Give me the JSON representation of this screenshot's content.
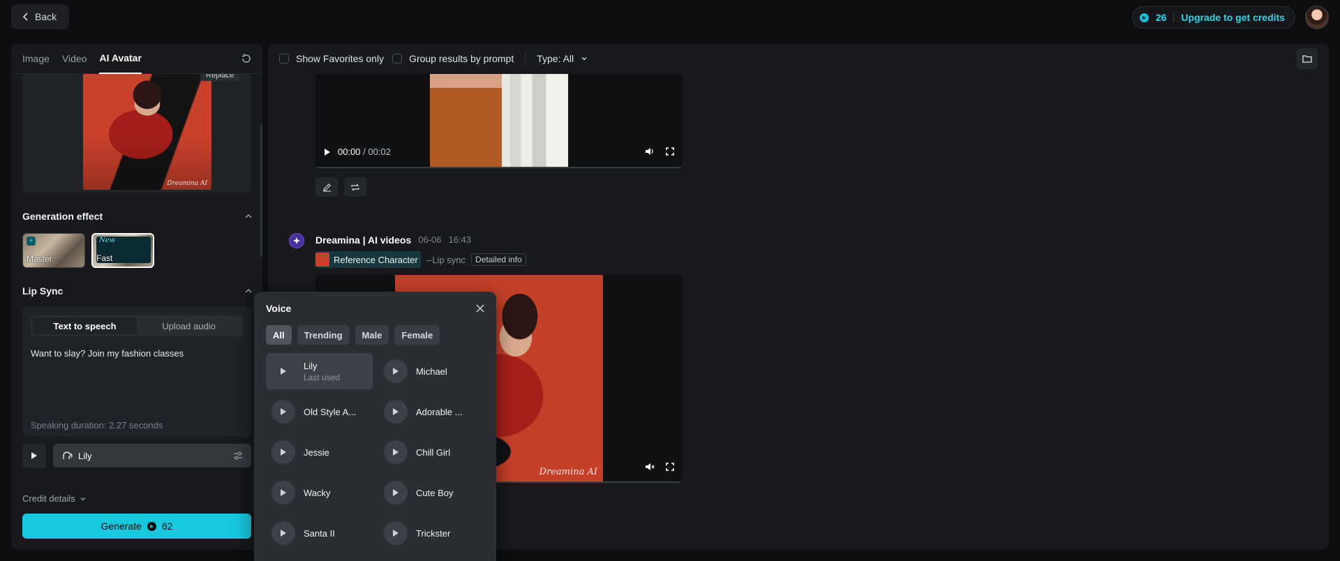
{
  "header": {
    "back_label": "Back",
    "credits": "26",
    "upgrade_label": "Upgrade to get credits"
  },
  "left": {
    "tabs": [
      {
        "label": "Image"
      },
      {
        "label": "Video"
      },
      {
        "label": "AI Avatar"
      }
    ],
    "replace_label": "Replace",
    "watermark": "Dreamina AI",
    "generation_effect": {
      "title": "Generation effect",
      "options": [
        {
          "label": "Master",
          "badge": "+"
        },
        {
          "label": "Fast",
          "badge": "New"
        }
      ]
    },
    "lip_sync": {
      "title": "Lip Sync",
      "modes": [
        {
          "label": "Text to speech"
        },
        {
          "label": "Upload audio"
        }
      ],
      "text": "Want to slay? Join my fashion classes",
      "duration": "Speaking duration: 2.27 seconds"
    },
    "voice_selected": "Lily",
    "credit_details": "Credit details",
    "generate_label": "Generate",
    "generate_cost": "62"
  },
  "right": {
    "toolbar": {
      "favorites": "Show Favorites only",
      "group": "Group results by prompt",
      "type": "Type: All"
    },
    "video1": {
      "time_current": "00:00",
      "time_separator": "/",
      "time_total": "00:02"
    },
    "generation": {
      "title": "Dreamina | AI videos",
      "date": "06-06",
      "time": "16:43",
      "ref_label": "Reference Character",
      "mode": "--Lip sync",
      "detail": "Detailed info",
      "watermark": "Dreamina AI"
    }
  },
  "voice_popup": {
    "title": "Voice",
    "filters": [
      {
        "label": "All"
      },
      {
        "label": "Trending"
      },
      {
        "label": "Male"
      },
      {
        "label": "Female"
      }
    ],
    "voices": [
      {
        "name": "Lily",
        "sub": "Last used"
      },
      {
        "name": "Michael",
        "sub": ""
      },
      {
        "name": "Old Style A...",
        "sub": ""
      },
      {
        "name": "Adorable ...",
        "sub": ""
      },
      {
        "name": "Jessie",
        "sub": ""
      },
      {
        "name": "Chill Girl",
        "sub": ""
      },
      {
        "name": "Wacky",
        "sub": ""
      },
      {
        "name": "Cute Boy",
        "sub": ""
      },
      {
        "name": "Santa II",
        "sub": ""
      },
      {
        "name": "Trickster",
        "sub": ""
      }
    ]
  },
  "colors": {
    "accent": "#18c7dd",
    "bg": "#0d0e10",
    "panel": "#17191c"
  }
}
